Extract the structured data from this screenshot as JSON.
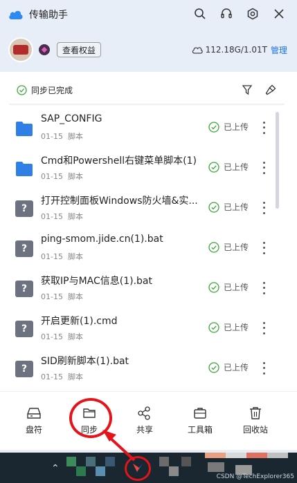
{
  "app": {
    "title": "传输助手"
  },
  "account": {
    "rights_button": "查看权益",
    "storage": "112.18G/1.01T",
    "manage": "管理"
  },
  "sync_status": "同步已完成",
  "files": [
    {
      "name": "SAP_CONFIG",
      "date": "01-15",
      "type": "脚本",
      "status": "已上传",
      "icon": "folder-icon"
    },
    {
      "name": "Cmd和Powershell右键菜单脚本(1)",
      "date": "01-15",
      "type": "脚本",
      "status": "已上传",
      "icon": "folder-icon"
    },
    {
      "name": "打开控制面板Windows防火墙&实...",
      "date": "01-15",
      "type": "脚本",
      "status": "已上传",
      "icon": "unknown-file-icon"
    },
    {
      "name": "ping-smom.jide.cn(1).bat",
      "date": "01-15",
      "type": "脚本",
      "status": "已上传",
      "icon": "unknown-file-icon"
    },
    {
      "name": "获取IP与MAC信息(1).bat",
      "date": "01-15",
      "type": "脚本",
      "status": "已上传",
      "icon": "unknown-file-icon"
    },
    {
      "name": "开启更新(1).cmd",
      "date": "01-15",
      "type": "脚本",
      "status": "已上传",
      "icon": "unknown-file-icon"
    },
    {
      "name": "SID刷新脚本(1).bat",
      "date": "01-15",
      "type": "脚本",
      "status": "已上传",
      "icon": "unknown-file-icon"
    }
  ],
  "nav": [
    {
      "label": "盘符",
      "icon": "drive-icon"
    },
    {
      "label": "同步",
      "icon": "folder-icon"
    },
    {
      "label": "共享",
      "icon": "share-icon"
    },
    {
      "label": "工具箱",
      "icon": "toolbox-icon"
    },
    {
      "label": "回收站",
      "icon": "trash-icon"
    }
  ],
  "watermark": "CSDN @TechExplorer365",
  "colors": {
    "accent": "#1a73e8",
    "folder": "#2f7fe6",
    "success": "#3aa63a",
    "annotation": "#e3141a"
  }
}
